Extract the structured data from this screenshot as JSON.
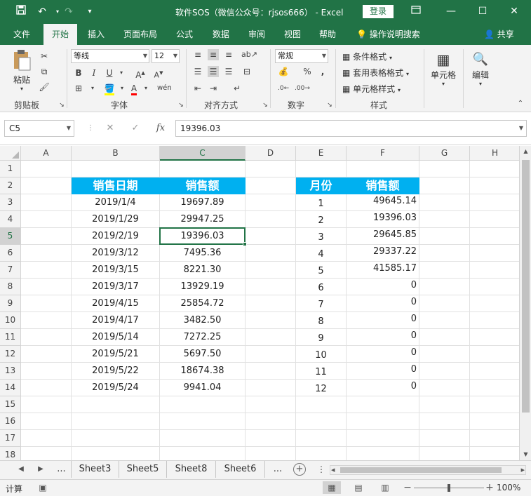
{
  "titlebar": {
    "title": "软件SOS（微信公众号：rjsos666） - Excel",
    "login_label": "登录",
    "save_icon": "save-icon",
    "undo_icon": "undo-icon",
    "redo_icon": "redo-icon"
  },
  "tabs": [
    {
      "label": "文件"
    },
    {
      "label": "开始"
    },
    {
      "label": "插入"
    },
    {
      "label": "页面布局"
    },
    {
      "label": "公式"
    },
    {
      "label": "数据"
    },
    {
      "label": "审阅"
    },
    {
      "label": "视图"
    },
    {
      "label": "帮助"
    }
  ],
  "tell_me": "操作说明搜索",
  "share": "共享",
  "ribbon": {
    "clipboard": {
      "paste": "粘贴",
      "label": "剪贴板"
    },
    "font": {
      "name": "等线",
      "size": "12",
      "label": "字体",
      "bold": "B",
      "italic": "I",
      "underline": "U"
    },
    "align": {
      "label": "对齐方式"
    },
    "number": {
      "format": "常规",
      "label": "数字",
      "percent": "%",
      "comma": ","
    },
    "styles": {
      "conditional": "条件格式",
      "table": "套用表格格式",
      "cell": "单元格样式",
      "label": "样式"
    },
    "cells": {
      "label": "单元格"
    },
    "editing": {
      "label": "编辑"
    }
  },
  "formula_bar": {
    "name_box": "C5",
    "fx": "fx",
    "formula": "19396.03"
  },
  "columns": [
    "A",
    "B",
    "C",
    "D",
    "E",
    "F",
    "G",
    "H"
  ],
  "rows": [
    "1",
    "2",
    "3",
    "4",
    "5",
    "6",
    "7",
    "8",
    "9",
    "10",
    "11",
    "12",
    "13",
    "14",
    "15",
    "16",
    "17",
    "18"
  ],
  "sales_table": {
    "header_date": "销售日期",
    "header_amount": "销售额",
    "rows": [
      {
        "date": "2019/1/4",
        "amount": "19697.89"
      },
      {
        "date": "2019/1/29",
        "amount": "29947.25"
      },
      {
        "date": "2019/2/19",
        "amount": "19396.03"
      },
      {
        "date": "2019/3/12",
        "amount": "7495.36"
      },
      {
        "date": "2019/3/15",
        "amount": "8221.30"
      },
      {
        "date": "2019/3/17",
        "amount": "13929.19"
      },
      {
        "date": "2019/4/15",
        "amount": "25854.72"
      },
      {
        "date": "2019/4/17",
        "amount": "3482.50"
      },
      {
        "date": "2019/5/14",
        "amount": "7272.25"
      },
      {
        "date": "2019/5/21",
        "amount": "5697.50"
      },
      {
        "date": "2019/5/22",
        "amount": "18674.38"
      },
      {
        "date": "2019/5/24",
        "amount": "9941.04"
      }
    ]
  },
  "month_table": {
    "header_month": "月份",
    "header_amount": "销售额",
    "rows": [
      {
        "month": "1",
        "amount": "49645.14"
      },
      {
        "month": "2",
        "amount": "19396.03"
      },
      {
        "month": "3",
        "amount": "29645.85"
      },
      {
        "month": "4",
        "amount": "29337.22"
      },
      {
        "month": "5",
        "amount": "41585.17"
      },
      {
        "month": "6",
        "amount": "0"
      },
      {
        "month": "7",
        "amount": "0"
      },
      {
        "month": "8",
        "amount": "0"
      },
      {
        "month": "9",
        "amount": "0"
      },
      {
        "month": "10",
        "amount": "0"
      },
      {
        "month": "11",
        "amount": "0"
      },
      {
        "month": "12",
        "amount": "0"
      }
    ]
  },
  "sheet_tabs": [
    {
      "label": "..."
    },
    {
      "label": "Sheet3"
    },
    {
      "label": "Sheet5"
    },
    {
      "label": "Sheet8"
    },
    {
      "label": "Sheet6"
    },
    {
      "label": "..."
    }
  ],
  "status": {
    "mode": "计算",
    "zoom": "100%"
  },
  "colors": {
    "excel_green": "#217346",
    "header_fill": "#00b0f0",
    "header_text": "#ffffff"
  }
}
